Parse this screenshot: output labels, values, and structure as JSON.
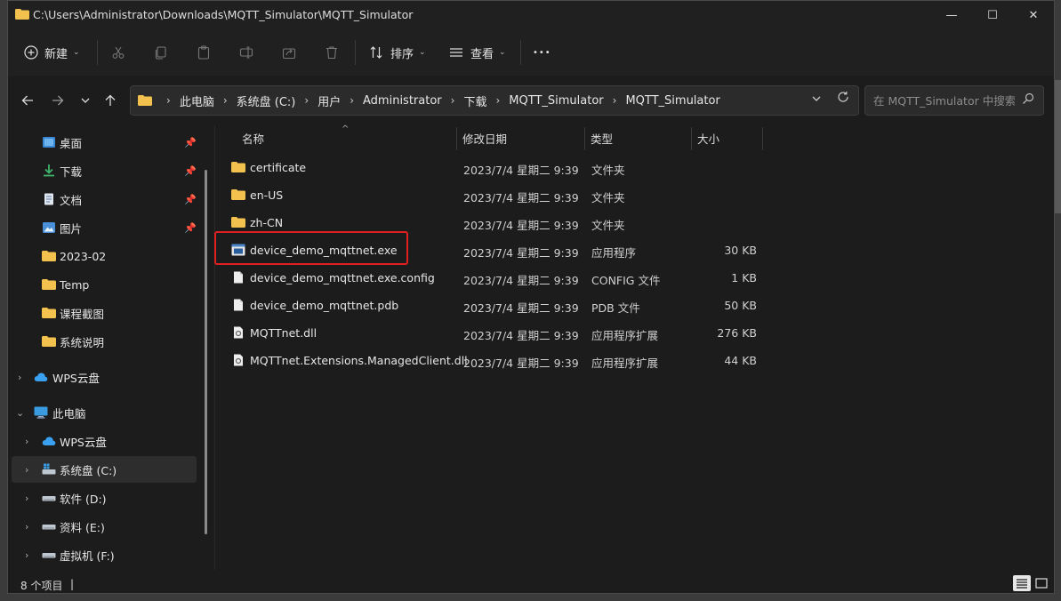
{
  "window": {
    "title": "C:\\Users\\Administrator\\Downloads\\MQTT_Simulator\\MQTT_Simulator",
    "minimize_glyph": "—",
    "maximize_glyph": "☐",
    "close_glyph": "✕"
  },
  "toolbar": {
    "new_label": "新建",
    "sort_label": "排序",
    "view_label": "查看",
    "more_glyph": "•••",
    "icons": [
      "plus-icon",
      "cut-icon",
      "copy-icon",
      "paste-icon",
      "rename-icon",
      "share-icon",
      "delete-icon",
      "sort-icon",
      "view-icon",
      "more-icon"
    ]
  },
  "address": {
    "crumbs": [
      "此电脑",
      "系统盘 (C:)",
      "用户",
      "Administrator",
      "下载",
      "MQTT_Simulator",
      "MQTT_Simulator"
    ],
    "search_placeholder": "在 MQTT_Simulator 中搜索"
  },
  "sidebar": {
    "quick_access": [
      {
        "label": "桌面",
        "icon": "desktop-icon",
        "pinned": true
      },
      {
        "label": "下载",
        "icon": "download-icon",
        "pinned": true
      },
      {
        "label": "文档",
        "icon": "document-icon",
        "pinned": true
      },
      {
        "label": "图片",
        "icon": "picture-icon",
        "pinned": true
      },
      {
        "label": "2023-02",
        "icon": "folder-icon",
        "pinned": false
      },
      {
        "label": "Temp",
        "icon": "folder-icon",
        "pinned": false
      },
      {
        "label": "课程截图",
        "icon": "folder-icon",
        "pinned": false
      },
      {
        "label": "系统说明",
        "icon": "folder-icon",
        "pinned": false
      }
    ],
    "wps_cloud": "WPS云盘",
    "this_pc": "此电脑",
    "pc_children": [
      {
        "label": "WPS云盘",
        "icon": "cloud-icon"
      },
      {
        "label": "系统盘 (C:)",
        "icon": "system-drive-icon",
        "selected": true
      },
      {
        "label": "软件 (D:)",
        "icon": "drive-icon"
      },
      {
        "label": "资料 (E:)",
        "icon": "drive-icon"
      },
      {
        "label": "虚拟机 (F:)",
        "icon": "drive-icon"
      }
    ]
  },
  "columns": {
    "name": "名称",
    "modified": "修改日期",
    "type": "类型",
    "size": "大小"
  },
  "files": [
    {
      "name": "certificate",
      "modified": "2023/7/4 星期二 9:39",
      "type": "文件夹",
      "size": "",
      "icon": "folder-icon"
    },
    {
      "name": "en-US",
      "modified": "2023/7/4 星期二 9:39",
      "type": "文件夹",
      "size": "",
      "icon": "folder-icon"
    },
    {
      "name": "zh-CN",
      "modified": "2023/7/4 星期二 9:39",
      "type": "文件夹",
      "size": "",
      "icon": "folder-icon"
    },
    {
      "name": "device_demo_mqttnet.exe",
      "modified": "2023/7/4 星期二 9:39",
      "type": "应用程序",
      "size": "30 KB",
      "icon": "exe-icon"
    },
    {
      "name": "device_demo_mqttnet.exe.config",
      "modified": "2023/7/4 星期二 9:39",
      "type": "CONFIG 文件",
      "size": "1 KB",
      "icon": "file-icon"
    },
    {
      "name": "device_demo_mqttnet.pdb",
      "modified": "2023/7/4 星期二 9:39",
      "type": "PDB 文件",
      "size": "50 KB",
      "icon": "file-icon"
    },
    {
      "name": "MQTTnet.dll",
      "modified": "2023/7/4 星期二 9:39",
      "type": "应用程序扩展",
      "size": "276 KB",
      "icon": "dll-icon"
    },
    {
      "name": "MQTTnet.Extensions.ManagedClient.dll",
      "modified": "2023/7/4 星期二 9:39",
      "type": "应用程序扩展",
      "size": "44 KB",
      "icon": "dll-icon"
    }
  ],
  "status": {
    "item_count": "8 个项目",
    "divider": "|"
  },
  "colors": {
    "folder": "#f2c14e",
    "highlight_box": "#e02020",
    "background": "#1c1c1c"
  }
}
